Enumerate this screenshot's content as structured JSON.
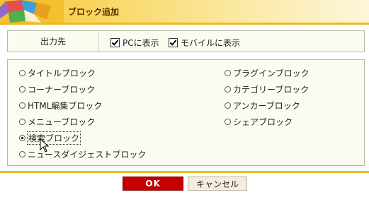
{
  "header": {
    "title": "ブロック追加"
  },
  "output": {
    "label": "出力先",
    "pc_label": "PCに表示",
    "pc_checked": true,
    "mobile_label": "モバイルに表示",
    "mobile_checked": true
  },
  "blocks": {
    "left": [
      {
        "label": "タイトルブロック",
        "selected": false
      },
      {
        "label": "コーナーブロック",
        "selected": false
      },
      {
        "label": "HTML編集ブロック",
        "selected": false
      },
      {
        "label": "メニューブロック",
        "selected": false
      },
      {
        "label": "検索ブロック",
        "selected": true
      },
      {
        "label": "ニュースダイジェストブロック",
        "selected": false
      }
    ],
    "right": [
      {
        "label": "プラグインブロック",
        "selected": false
      },
      {
        "label": "カテゴリーブロック",
        "selected": false
      },
      {
        "label": "アンカーブロック",
        "selected": false
      },
      {
        "label": "シェアブロック",
        "selected": false
      }
    ]
  },
  "buttons": {
    "ok": "OK",
    "cancel": "キャンセル"
  },
  "colors": {
    "accent": "#f0b820",
    "ok_bg": "#c40000",
    "panel_bg": "#fbfbf1"
  }
}
